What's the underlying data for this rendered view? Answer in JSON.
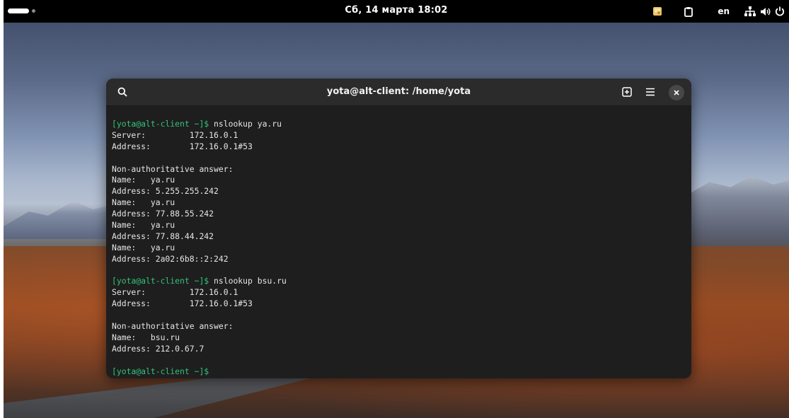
{
  "topbar": {
    "clock": "Сб, 14 марта 18:02",
    "language": "en",
    "icons": [
      "activities-indicator",
      "screenshot-indicator-icon",
      "clipboard-icon",
      "network-icon",
      "volume-icon",
      "power-icon"
    ]
  },
  "terminal": {
    "title": "yota@alt-client: /home/yota",
    "lines": [
      {
        "prompt": "[yota@alt-client ~]$",
        "cmd": " nslookup ya.ru"
      },
      {
        "text": "Server:         172.16.0.1"
      },
      {
        "text": "Address:        172.16.0.1#53"
      },
      {
        "text": ""
      },
      {
        "text": "Non-authoritative answer:"
      },
      {
        "text": "Name:   ya.ru"
      },
      {
        "text": "Address: 5.255.255.242"
      },
      {
        "text": "Name:   ya.ru"
      },
      {
        "text": "Address: 77.88.55.242"
      },
      {
        "text": "Name:   ya.ru"
      },
      {
        "text": "Address: 77.88.44.242"
      },
      {
        "text": "Name:   ya.ru"
      },
      {
        "text": "Address: 2a02:6b8::2:242"
      },
      {
        "text": ""
      },
      {
        "prompt": "[yota@alt-client ~]$",
        "cmd": " nslookup bsu.ru"
      },
      {
        "text": "Server:         172.16.0.1"
      },
      {
        "text": "Address:        172.16.0.1#53"
      },
      {
        "text": ""
      },
      {
        "text": "Non-authoritative answer:"
      },
      {
        "text": "Name:   bsu.ru"
      },
      {
        "text": "Address: 212.0.67.7"
      },
      {
        "text": ""
      },
      {
        "prompt": "[yota@alt-client ~]$",
        "cmd": ""
      }
    ]
  },
  "colors": {
    "prompt": "#33c37a",
    "terminal_bg": "#1e1e1e",
    "titlebar_bg": "#2b2b2b",
    "topbar_bg": "#000000"
  }
}
